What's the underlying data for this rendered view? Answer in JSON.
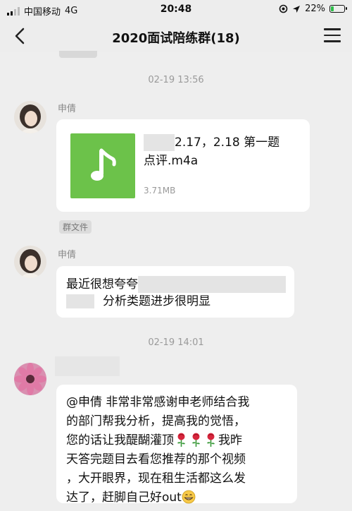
{
  "status_bar": {
    "carrier": "中国移动",
    "network": "4G",
    "time": "20:48",
    "battery": "22%",
    "battery_level": 0.22
  },
  "header": {
    "title": "2020面试陪练群(18)"
  },
  "messages": [
    {
      "timestamp": "02-19 13:56",
      "sender": "申倩",
      "file": {
        "name_line1": "2.17，2.18 第一题",
        "name_line2": "点评.m4a",
        "size": "3.71MB",
        "icon": "music-note-icon"
      },
      "tag": "群文件"
    },
    {
      "sender": "申倩",
      "text_line1": "最近很想夸夸",
      "text_line2": "分析类题进步很明显"
    },
    {
      "timestamp": "02-19 14:01",
      "text_line1": "@申倩 非常非常感谢申老师结合我",
      "text_line2": "的部门帮我分析，提高我的觉悟，",
      "text_line3a": "您的话让我醍醐灌顶",
      "text_line3b": "我昨",
      "text_line4": "天答完题目去看您推荐的那个视频",
      "text_line5": "，大开眼界，现在租生活都这么发",
      "text_line6": "达了，赶脚自己好out"
    }
  ],
  "colors": {
    "background": "#eeeeee",
    "bubble": "#ffffff",
    "file_icon": "#6cc24a",
    "battery_fill": "#2dbf4a"
  }
}
